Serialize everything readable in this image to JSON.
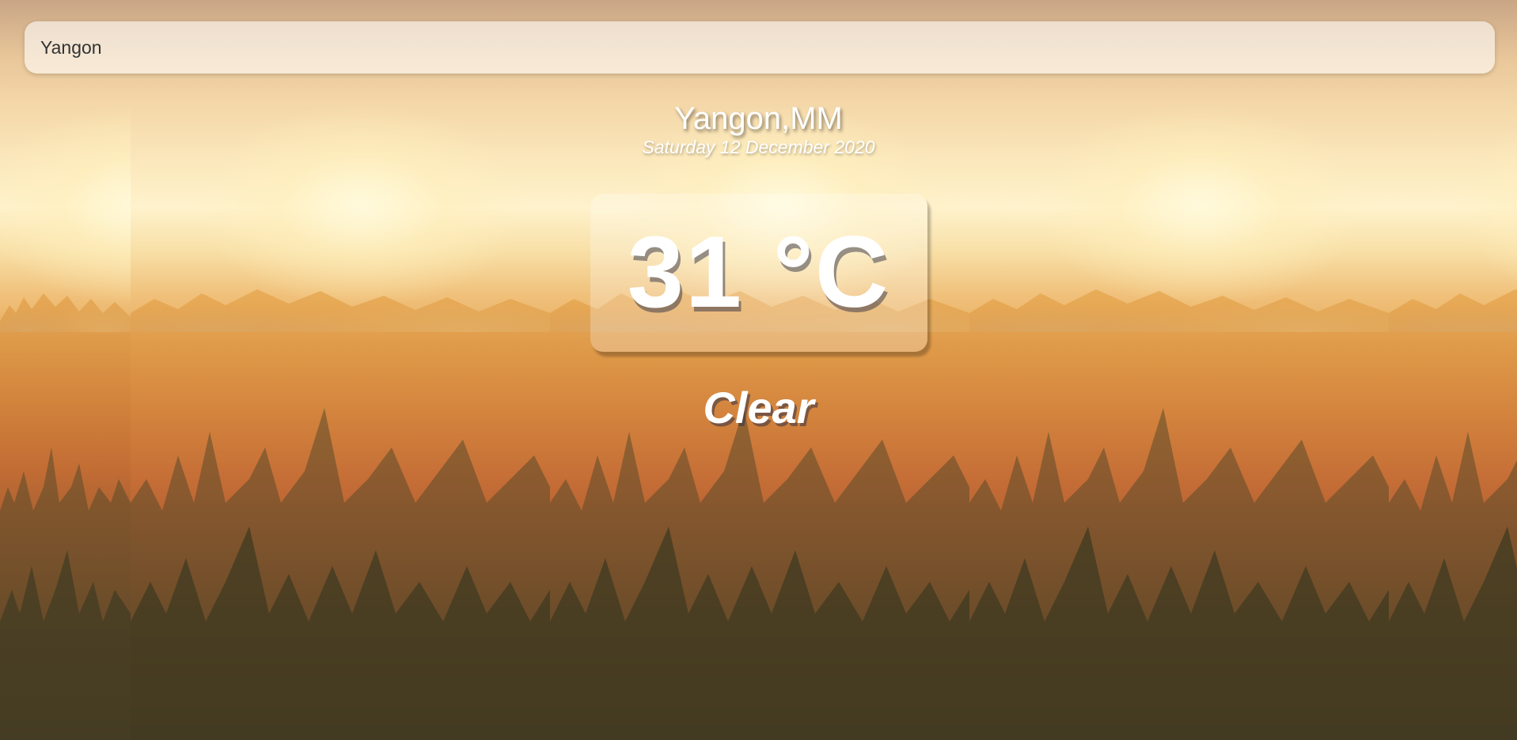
{
  "search": {
    "value": "Yangon",
    "placeholder": "Search..."
  },
  "location": {
    "city": "Yangon,MM",
    "date": "Saturday 12 December 2020"
  },
  "weather": {
    "temperature": "31 °C",
    "condition": "Clear"
  },
  "theme": {
    "background": "warm sunrise forest landscape",
    "text_color": "#ffffff"
  }
}
